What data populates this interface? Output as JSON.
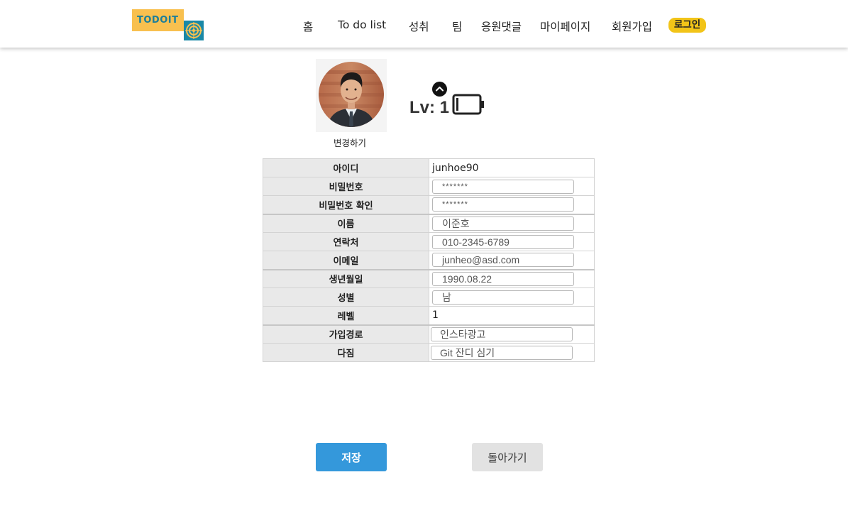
{
  "header": {
    "logo_text": "TODOIT",
    "nav": [
      {
        "label": "홈"
      },
      {
        "label": "To do list"
      },
      {
        "label": "성취"
      },
      {
        "label": "팀"
      },
      {
        "label": "응원댓글"
      },
      {
        "label": "마이페이지"
      },
      {
        "label": "회원가입"
      }
    ],
    "login_label": "로그인"
  },
  "profile": {
    "change_photo_label": "변경하기",
    "level_text": "Lv: 1",
    "level_up_icon": "chevron-up-icon",
    "battery_icon": "battery-empty-icon"
  },
  "form": {
    "rows": [
      {
        "label": "아이디",
        "value": "junhoe90"
      },
      {
        "label": "비밀번호",
        "value": "*******"
      },
      {
        "label": "비밀번호 확인",
        "value": "*******"
      },
      {
        "label": "이름",
        "value": "이준호"
      },
      {
        "label": "연락처",
        "value": "010-2345-6789"
      },
      {
        "label": "이메일",
        "value": "junheo@asd.com"
      },
      {
        "label": "생년월일",
        "value": "1990.08.22"
      },
      {
        "label": "성별",
        "value": "남"
      },
      {
        "label": "레벨",
        "value": "1"
      },
      {
        "label": "가입경로",
        "value": "인스타광고"
      },
      {
        "label": "다짐",
        "value": "Git 잔디 심기"
      }
    ]
  },
  "buttons": {
    "save_label": "저장",
    "back_label": "돌아가기"
  },
  "colors": {
    "accent": "#3498db",
    "login_badge": "#f2c418",
    "logo_yellow": "#f8c04f",
    "logo_teal": "#1a88a6",
    "label_bg": "#e9e9e9"
  }
}
